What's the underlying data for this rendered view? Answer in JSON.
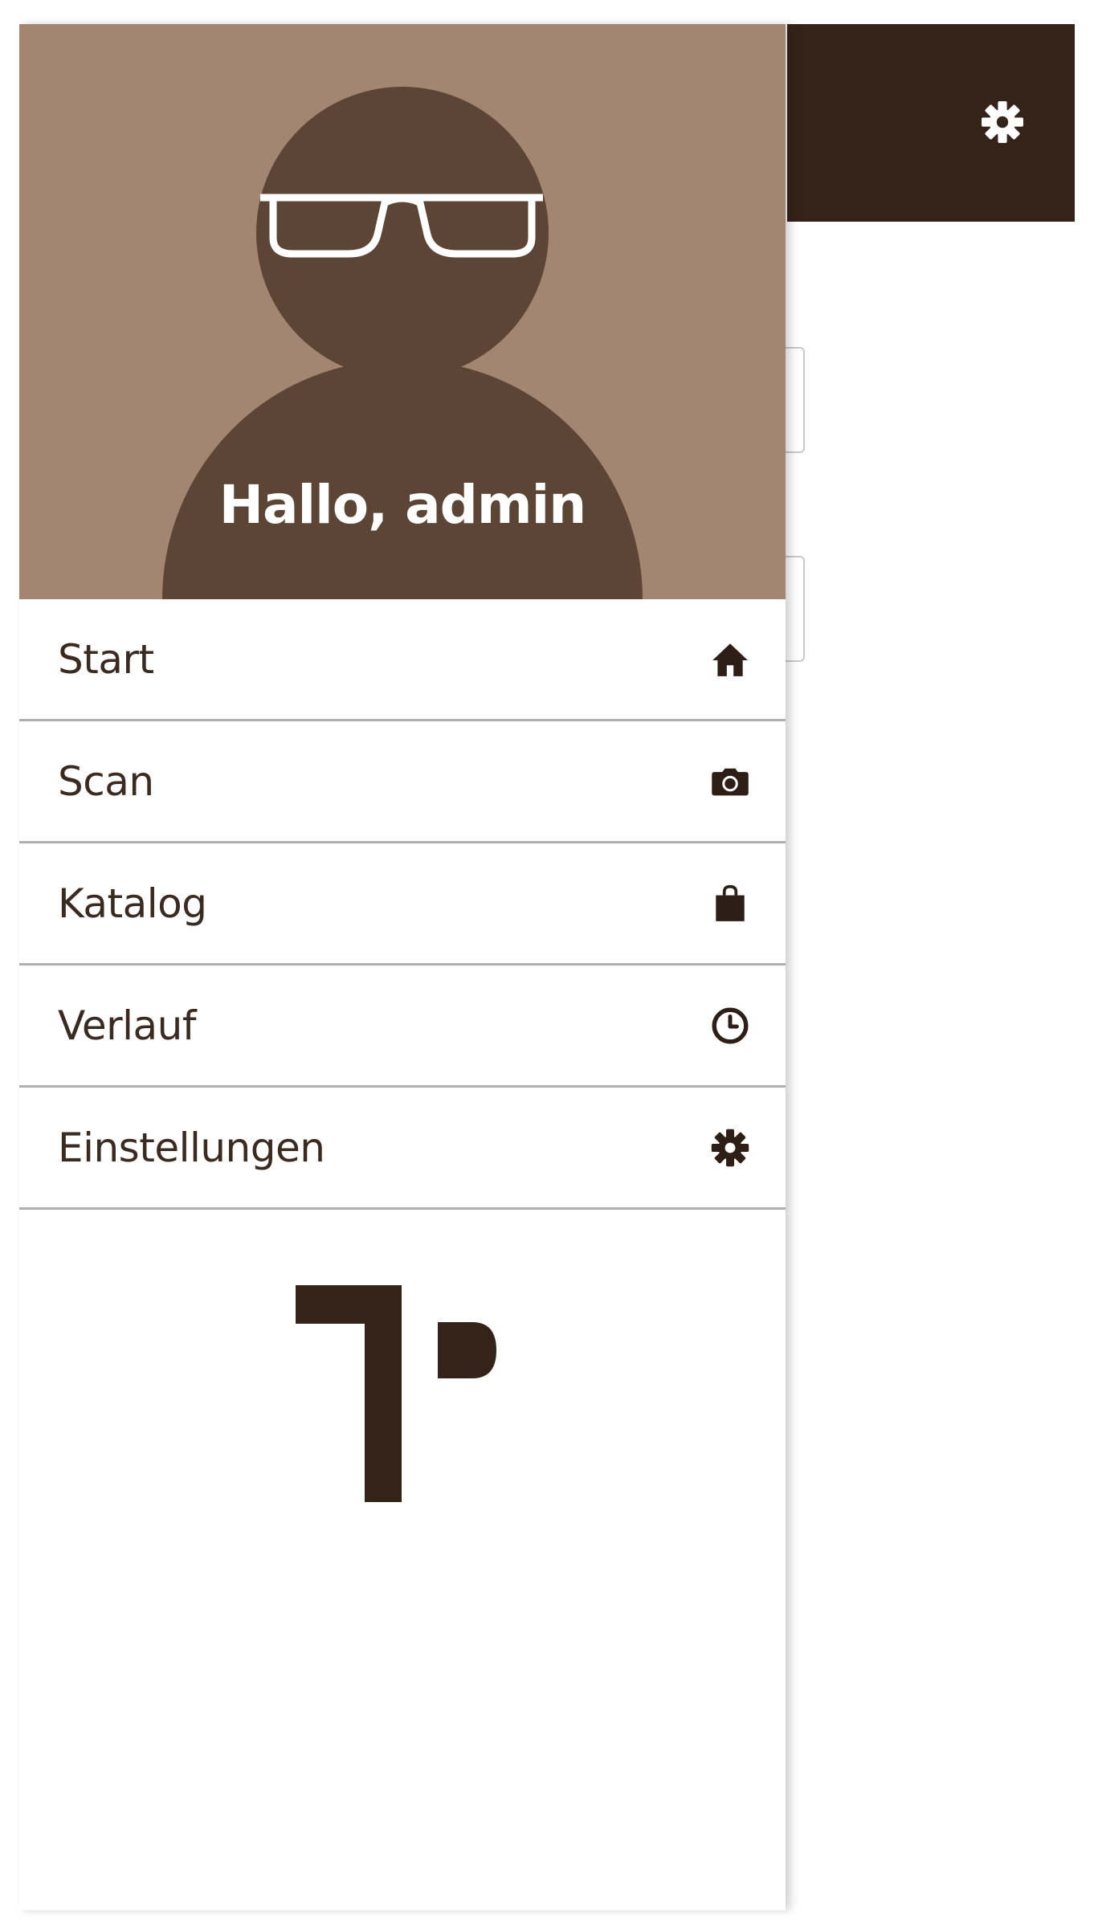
{
  "colors": {
    "topbar": "#35231a",
    "header_bg": "#a38672",
    "avatar_figure": "#5d4535",
    "menu_text": "#3a2a20",
    "divider": "#b0b0b0",
    "icon_dark": "#2e1f16"
  },
  "topbar": {
    "settings_icon": "gear-icon"
  },
  "drawer": {
    "greeting": "Hallo, admin",
    "menu": [
      {
        "label": "Start",
        "icon": "home-icon"
      },
      {
        "label": "Scan",
        "icon": "camera-icon"
      },
      {
        "label": "Katalog",
        "icon": "shopping-bag-icon"
      },
      {
        "label": "Verlauf",
        "icon": "clock-icon"
      },
      {
        "label": "Einstellungen",
        "icon": "gear-icon"
      }
    ]
  }
}
